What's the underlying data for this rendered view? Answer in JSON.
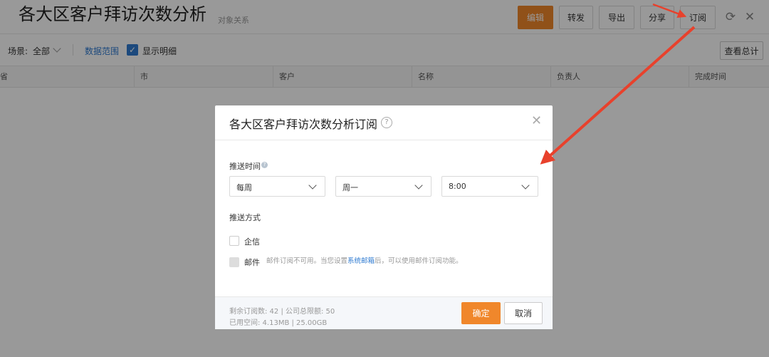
{
  "header": {
    "title": "各大区客户拜访次数分析",
    "subtitle": "对象关系",
    "buttons": {
      "edit": "编辑",
      "forward": "转发",
      "export": "导出",
      "share": "分享",
      "subscribe": "订阅"
    },
    "icons": {
      "refresh": "refresh-icon",
      "close": "close-icon"
    }
  },
  "toolbar": {
    "scene_label": "场景:",
    "scene_value": "全部",
    "data_range_link": "数据范围",
    "show_detail_checked": true,
    "show_detail_label": "显示明细",
    "view_total_button": "查看总计"
  },
  "table": {
    "columns": [
      "省",
      "市",
      "客户",
      "名称",
      "负责人",
      "完成时间"
    ]
  },
  "modal": {
    "title": "各大区客户拜访次数分析订阅",
    "push_time": {
      "label": "推送时间",
      "frequency": "每周",
      "day": "周一",
      "time": "8:00"
    },
    "push_method": {
      "label": "推送方式",
      "qixin": {
        "label": "企信",
        "checked": false
      },
      "email": {
        "label": "邮件",
        "disabled": true,
        "hint_before": "邮件订阅不可用。当您设置",
        "hint_link": "系统邮箱",
        "hint_after": "后，可以使用邮件订阅功能。"
      }
    },
    "footer": {
      "remaining": "剩余订阅数: 42 | 公司总限额: 50",
      "space_used": "已用空间: 4.13MB | 25.00GB",
      "confirm": "确定",
      "cancel": "取消"
    }
  },
  "colors": {
    "accent": "#f0872b",
    "link": "#2f7bd1",
    "arrow": "#e8412c",
    "overlay": "rgba(0,0,0,0.40)"
  }
}
